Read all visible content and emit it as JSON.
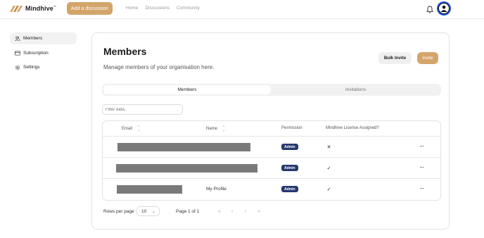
{
  "header": {
    "logo_text": "Mindhive",
    "logo_tm": "™",
    "add_discussion_label": "Add a discussion",
    "nav": [
      {
        "label": "Home"
      },
      {
        "label": "Discussions"
      },
      {
        "label": "Community"
      }
    ],
    "icons": {
      "bell": "bell-icon",
      "avatar": "user-avatar-icon"
    },
    "colors": {
      "accent": "#d4a56a",
      "avatar_ring": "#1e4fd8"
    }
  },
  "sidebar": {
    "items": [
      {
        "label": "Members",
        "icon": "users-icon",
        "active": true
      },
      {
        "label": "Subscription",
        "icon": "credit-card-icon",
        "active": false
      },
      {
        "label": "Settings",
        "icon": "gear-icon",
        "active": false
      }
    ]
  },
  "main": {
    "title": "Members",
    "subtitle": "Manage members of your organisation here.",
    "bulk_invite_label": "Bulk Invite",
    "invite_label": "Invite",
    "tabs": [
      {
        "label": "Members",
        "active": true
      },
      {
        "label": "Invitations",
        "active": false
      }
    ],
    "filter_placeholder": "Filter data..",
    "table": {
      "columns": [
        "Email",
        "Name",
        "Permission",
        "Mindhive License Assigned?"
      ],
      "rows": [
        {
          "email_redacted": true,
          "name": "",
          "permission": "Admin",
          "license": "✕",
          "actions": "···"
        },
        {
          "email_redacted": true,
          "name": "",
          "permission": "Admin",
          "license": "✓",
          "actions": "···"
        },
        {
          "email_redacted": true,
          "name": "My Profile",
          "permission": "Admin",
          "license": "✓",
          "actions": "···"
        }
      ]
    },
    "pagination": {
      "rows_per_page_label": "Rows per page",
      "rows_per_page_value": "10",
      "page_info": "Page 1 of 1",
      "buttons": [
        "«",
        "‹",
        "›",
        "»"
      ]
    },
    "colors": {
      "badge": "#26386e",
      "redaction": "#7a7a7a"
    }
  }
}
